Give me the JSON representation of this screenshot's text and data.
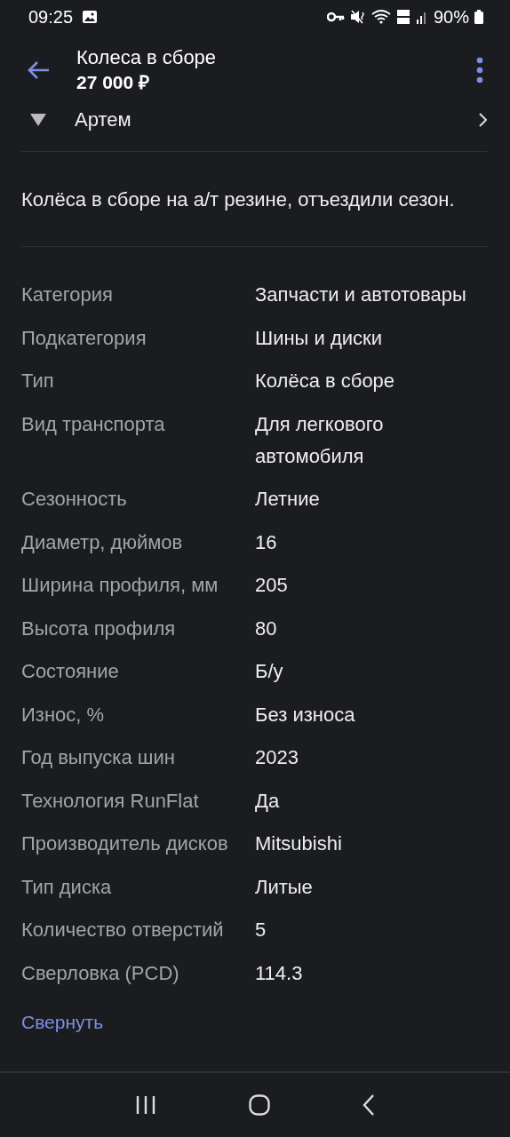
{
  "status_bar": {
    "time": "09:25",
    "battery": "90%"
  },
  "header": {
    "title": "Колеса в сборе",
    "price": "27 000 ₽"
  },
  "seller": {
    "name": "Артем"
  },
  "description": "Колёса в сборе на а/т резине, отъездили сезон.",
  "params": [
    {
      "label": "Категория",
      "value": "Запчасти и автотовары"
    },
    {
      "label": "Подкатегория",
      "value": "Шины и диски"
    },
    {
      "label": "Тип",
      "value": "Колёса в сборе"
    },
    {
      "label": "Вид транспорта",
      "value": "Для легкового автомобиля"
    },
    {
      "label": "Сезонность",
      "value": "Летние"
    },
    {
      "label": "Диаметр, дюймов",
      "value": "16"
    },
    {
      "label": "Ширина профиля, мм",
      "value": "205"
    },
    {
      "label": "Высота профиля",
      "value": "80"
    },
    {
      "label": "Состояние",
      "value": "Б/у"
    },
    {
      "label": "Износ, %",
      "value": "Без износа"
    },
    {
      "label": "Год выпуска шин",
      "value": "2023"
    },
    {
      "label": "Технология RunFlat",
      "value": "Да"
    },
    {
      "label": "Производитель дисков",
      "value": "Mitsubishi"
    },
    {
      "label": "Тип диска",
      "value": "Литые"
    },
    {
      "label": "Количество отверстий",
      "value": "5"
    },
    {
      "label": "Сверловка (PCD)",
      "value": "114.3"
    }
  ],
  "collapse_link": "Свернуть"
}
